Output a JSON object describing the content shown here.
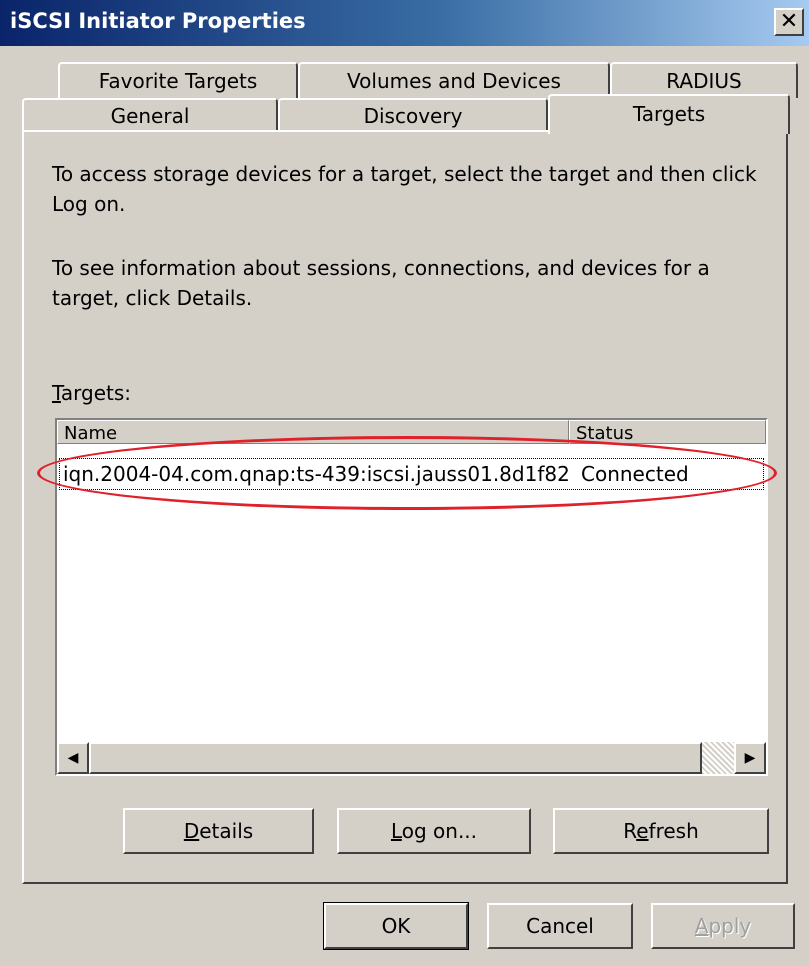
{
  "window": {
    "title": "iSCSI Initiator Properties",
    "close_glyph": "✕"
  },
  "tabs": {
    "back_row": [
      {
        "label": "Favorite Targets"
      },
      {
        "label": "Volumes and Devices"
      },
      {
        "label": "RADIUS"
      }
    ],
    "front_row": [
      {
        "label": "General"
      },
      {
        "label": "Discovery"
      },
      {
        "label": "Targets"
      }
    ],
    "active": "Targets"
  },
  "panel": {
    "instruction_1": "To access storage devices for a target, select the target and then click Log on.",
    "instruction_2": "To see information about sessions, connections, and devices for a target, click Details.",
    "targets_label_mnemonic": "T",
    "targets_label_rest": "argets:"
  },
  "targets_list": {
    "columns": [
      {
        "label": "Name"
      },
      {
        "label": "Status"
      }
    ],
    "rows": [
      {
        "name": "iqn.2004-04.com.qnap:ts-439:iscsi.jauss01.8d1f82",
        "status": "Connected"
      }
    ],
    "highlight_color": "#e0202a"
  },
  "scrollbar": {
    "left_arrow": "◀",
    "right_arrow": "▶"
  },
  "panel_buttons": {
    "details": {
      "mnemonic": "D",
      "rest": "etails"
    },
    "log_on": {
      "mnemonic": "L",
      "rest": "og on..."
    },
    "refresh": {
      "pre": "R",
      "mnemonic": "e",
      "rest": "fresh"
    }
  },
  "dialog_buttons": {
    "ok": "OK",
    "cancel": "Cancel",
    "apply": {
      "mnemonic": "A",
      "rest": "pply",
      "enabled": false
    }
  }
}
